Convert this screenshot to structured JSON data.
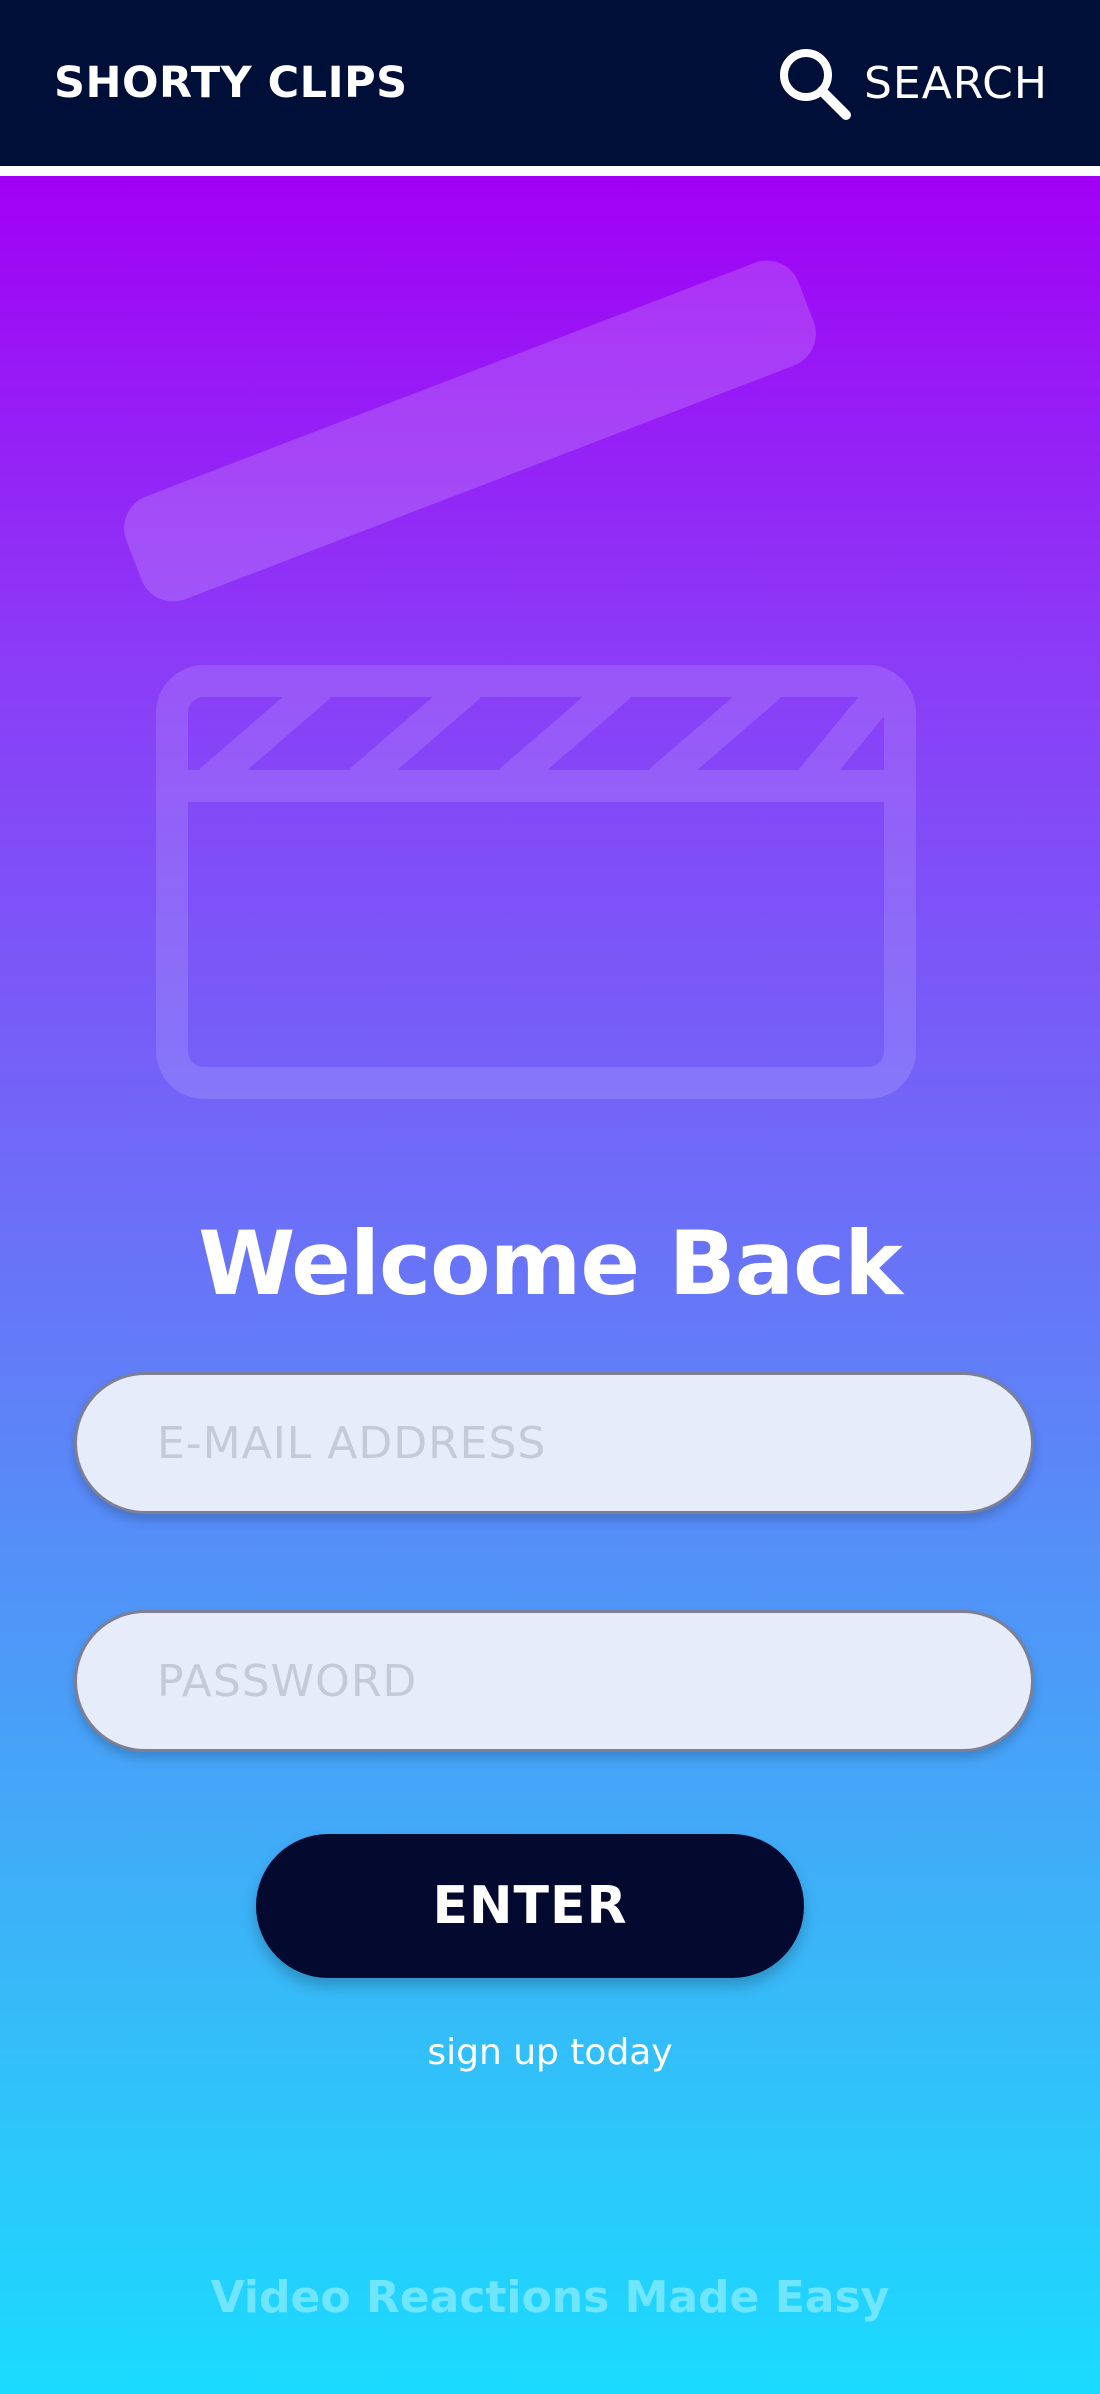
{
  "header": {
    "brand": "SHORTY CLIPS",
    "search_label": "SEARCH",
    "search_icon": "search-icon",
    "background": "#000f38"
  },
  "hero": {
    "icon": "clapperboard-icon"
  },
  "login": {
    "title": "Welcome Back",
    "email_placeholder": "E-MAIL ADDRESS",
    "password_placeholder": "PASSWORD",
    "enter_label": "ENTER",
    "signup_label": "sign up today"
  },
  "footer": {
    "tagline": "Video Reactions Made Easy"
  },
  "colors": {
    "gradient_top": "#a100f5",
    "gradient_bottom": "#1adbff",
    "button": "#03092f",
    "field_bg": "#e6ecfa"
  }
}
